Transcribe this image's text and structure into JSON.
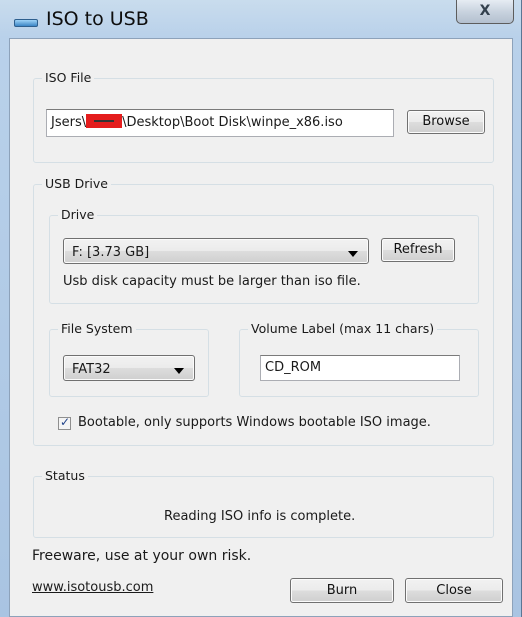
{
  "window": {
    "title": "ISO to USB",
    "close_glyph": "X"
  },
  "iso_file": {
    "legend": "ISO File",
    "path_prefix": "Jsers\\",
    "path_suffix": "\\Desktop\\Boot Disk\\winpe_x86.iso",
    "browse_label": "Browse"
  },
  "usb_drive": {
    "legend": "USB Drive",
    "drive": {
      "legend": "Drive",
      "selected": "F: [3.73 GB]",
      "refresh_label": "Refresh",
      "note": "Usb disk capacity must be larger than iso file."
    },
    "file_system": {
      "legend": "File System",
      "selected": "FAT32"
    },
    "volume_label": {
      "legend": "Volume Label (max 11 chars)",
      "value": "CD_ROM"
    },
    "bootable": {
      "checked": true,
      "label": "Bootable, only supports Windows bootable ISO image."
    }
  },
  "status": {
    "legend": "Status",
    "message": "Reading ISO info is complete."
  },
  "footer": {
    "disclaimer": "Freeware, use at your own risk.",
    "website": "www.isotousb.com",
    "burn_label": "Burn",
    "close_label": "Close"
  },
  "colors": {
    "frame": "#b9d1ea",
    "client": "#f0f0f0",
    "redaction": "#e41d1d"
  }
}
